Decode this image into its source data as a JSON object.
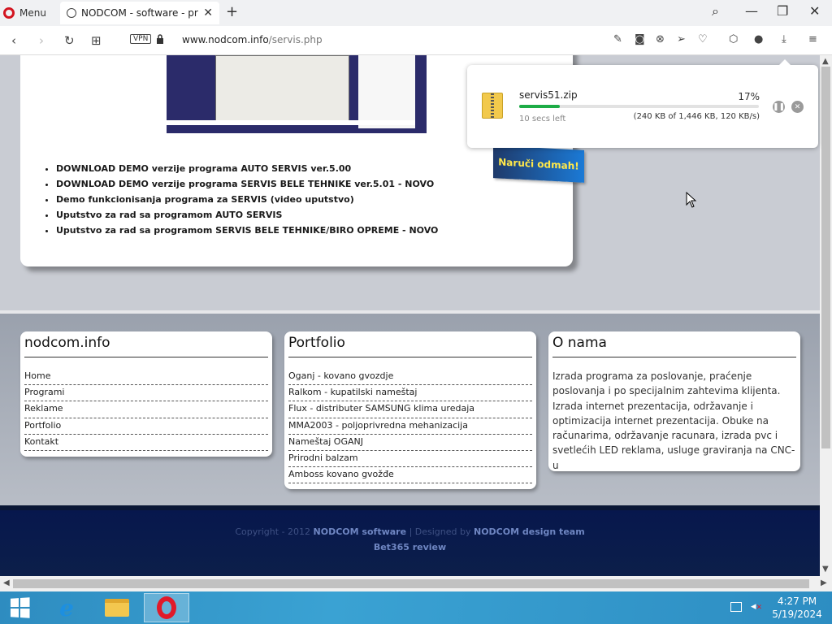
{
  "browser": {
    "menu_label": "Menu",
    "tab_title": "NODCOM - software - pro",
    "url_host": "www.nodcom.info",
    "url_path": "/servis.php",
    "vpn_label": "VPN"
  },
  "content": {
    "links": [
      "DOWNLOAD DEMO verzije programa AUTO SERVIS ver.5.00",
      "DOWNLOAD DEMO verzije programa SERVIS BELE TEHNIKE ver.5.01 - NOVO",
      "Demo funkcionisanja programa za SERVIS (video uputstvo)",
      "Uputstvo za rad sa programom AUTO SERVIS",
      "Uputstvo za rad sa programom SERVIS BELE TEHNIKE/BIRO OPREME - NOVO"
    ],
    "order_button": "Naruči odmah!"
  },
  "footer": {
    "box1": {
      "title": "nodcom.info",
      "items": [
        "Home",
        "Programi",
        "Reklame",
        "Portfolio",
        "Kontakt"
      ]
    },
    "box2": {
      "title": "Portfolio",
      "items": [
        "Oganj - kovano gvozdje",
        "Ralkom - kupatilski nameštaj",
        "Flux - distributer SAMSUNG klima uredaja",
        "MMA2003 - poljoprivredna mehanizacija",
        "Nameštaj OGANJ",
        "Prirodni balzam",
        "Amboss kovano gvožđe"
      ]
    },
    "box3": {
      "title": "O nama",
      "text": "Izrada programa za poslovanje, praćenje poslovanja i po specijalnim zahtevima klijenta. Izrada internet prezentacija, održavanje i optimizacija internet prezentacija. Obuke na računarima, održavanje racunara, izrada pvc i svetlećih LED reklama, usluge graviranja na CNC-u"
    },
    "copyright_prefix": "Copyright - 2012",
    "copyright_brand": "NODCOM software",
    "copyright_sep": "| Designed by",
    "copyright_designer": "NODCOM design team",
    "bet_link": "Bet365 review"
  },
  "download": {
    "filename": "servis51.zip",
    "percent_label": "17%",
    "progress": 0.17,
    "time_left": "10 secs left",
    "size_info": "(240 KB of 1,446 KB, 120 KB/s)"
  },
  "taskbar": {
    "time": "4:27 PM",
    "date": "5/19/2024"
  },
  "colors": {
    "opera_red": "#d3141f",
    "progress_green": "#1dac46",
    "order_text": "#ffe84a",
    "footer_dark": "#07174d"
  }
}
